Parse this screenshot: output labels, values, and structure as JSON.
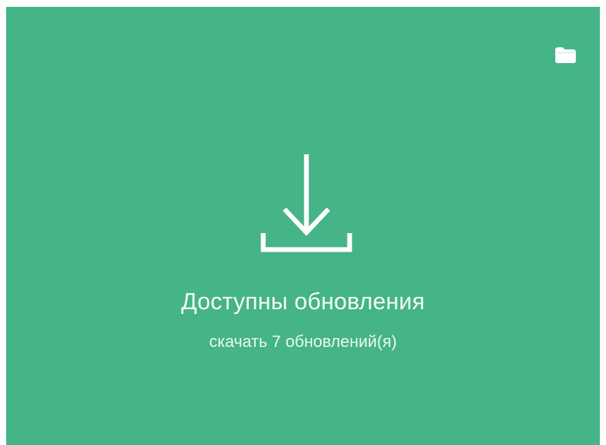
{
  "colors": {
    "panel_background": "#45b486",
    "foreground": "#ffffff"
  },
  "header": {
    "folder_icon": "folder-icon"
  },
  "main": {
    "download_icon": "download-icon",
    "title": "Доступны обновления",
    "subtitle": "скачать 7 обновлений(я)"
  }
}
